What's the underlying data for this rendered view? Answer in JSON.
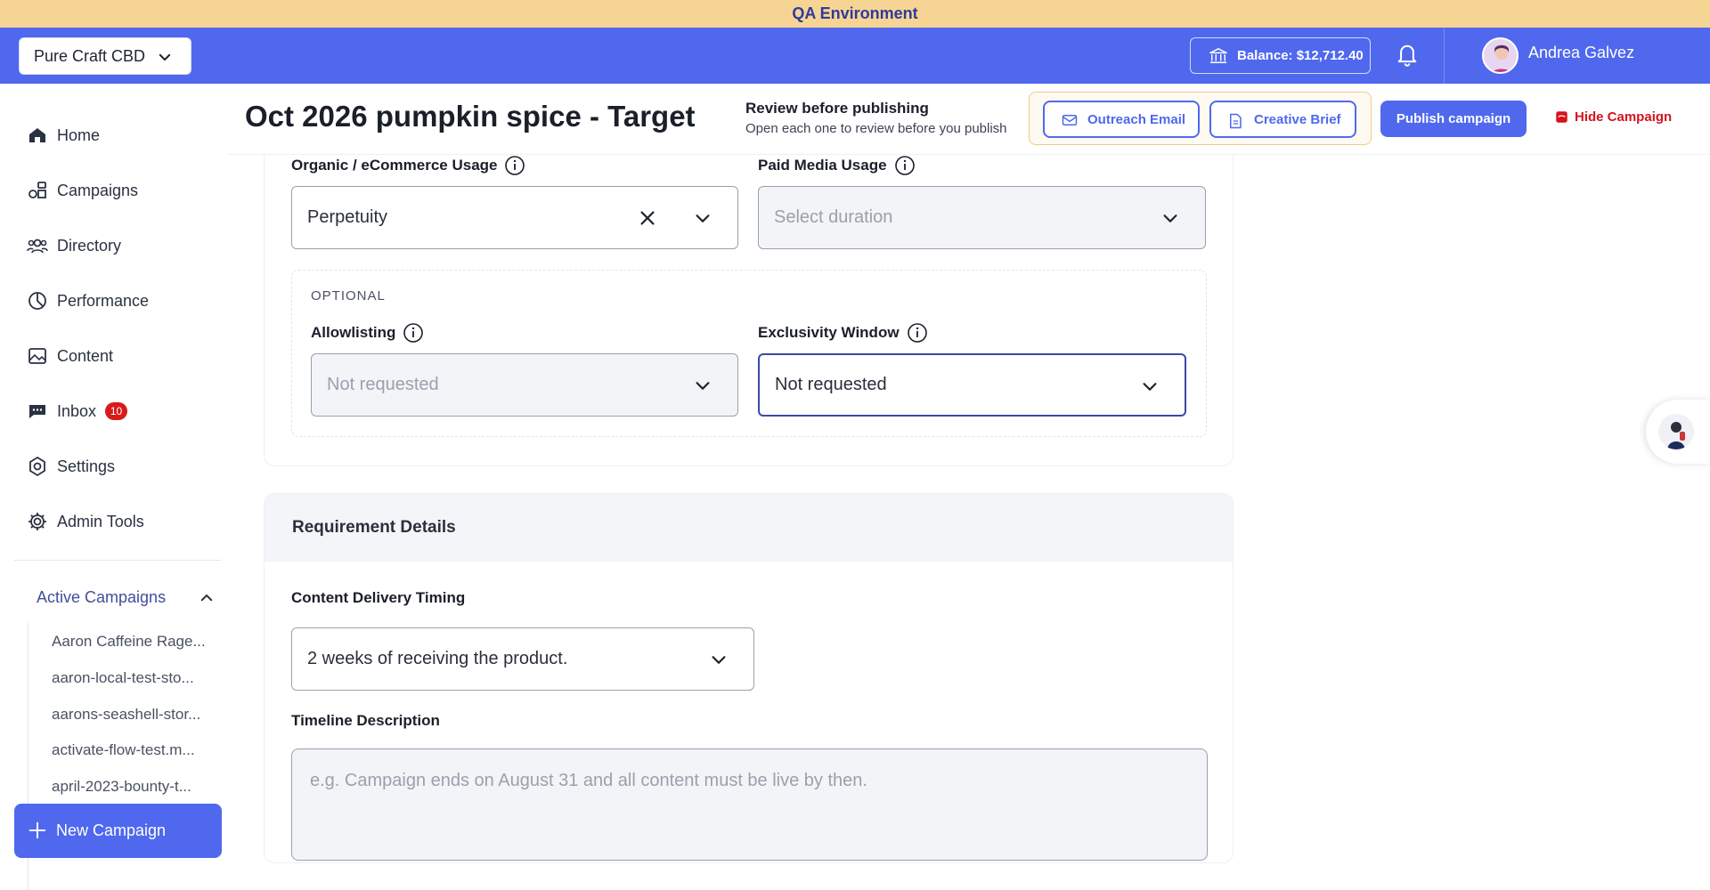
{
  "environment_banner": "QA Environment",
  "topbar": {
    "brand_selector": "Pure Craft CBD",
    "balance": "Balance: $12,712.40",
    "user_name": "Andrea Galvez"
  },
  "sidebar": {
    "nav": [
      {
        "label": "Home",
        "icon": "home-icon"
      },
      {
        "label": "Campaigns",
        "icon": "campaigns-icon"
      },
      {
        "label": "Directory",
        "icon": "directory-icon"
      },
      {
        "label": "Performance",
        "icon": "performance-icon"
      },
      {
        "label": "Content",
        "icon": "content-icon"
      },
      {
        "label": "Inbox",
        "icon": "inbox-icon",
        "badge": "10"
      },
      {
        "label": "Settings",
        "icon": "settings-icon"
      },
      {
        "label": "Admin Tools",
        "icon": "admin-tools-icon"
      }
    ],
    "active_campaigns_label": "Active Campaigns",
    "active_campaigns": [
      "Aaron Caffeine Rage...",
      "aaron-local-test-sto...",
      "aarons-seashell-stor...",
      "activate-flow-test.m...",
      "april-2023-bounty-t..."
    ],
    "new_campaign": "New Campaign"
  },
  "header": {
    "title": "Oct 2026 pumpkin spice - Target",
    "review_title": "Review before publishing",
    "review_subtitle": "Open each one to review before you publish",
    "outreach_email": "Outreach Email",
    "creative_brief": "Creative Brief",
    "publish": "Publish campaign",
    "hide": "Hide Campaign"
  },
  "usage": {
    "organic_label": "Organic / eCommerce Usage",
    "organic_value": "Perpetuity",
    "paid_label": "Paid Media Usage",
    "paid_placeholder": "Select duration",
    "optional_label": "OPTIONAL",
    "allowlisting_label": "Allowlisting",
    "allowlisting_value": "Not requested",
    "exclusivity_label": "Exclusivity Window",
    "exclusivity_value": "Not requested"
  },
  "requirements": {
    "title": "Requirement Details",
    "delivery_label": "Content Delivery Timing",
    "delivery_value": "2 weeks of receiving the product.",
    "timeline_label": "Timeline Description",
    "timeline_placeholder": "e.g. Campaign ends on August 31 and all content must be live by then."
  },
  "colors": {
    "primary": "#4f68ee",
    "banner": "#f6d493",
    "danger": "#d5131f",
    "badge": "#d91a1a"
  }
}
